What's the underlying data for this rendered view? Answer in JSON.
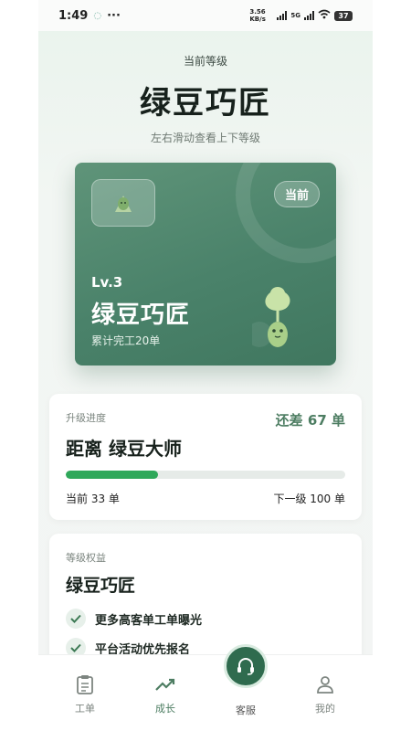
{
  "status_bar": {
    "time": "1:49",
    "speed": "3.56 KB/s",
    "network": "5G",
    "battery": "37"
  },
  "header": {
    "subtitle": "当前等级",
    "title": "绿豆巧匠",
    "hint": "左右滑动查看上下等级"
  },
  "level_card": {
    "tag": "当前",
    "level": "Lv.3",
    "name": "绿豆巧匠",
    "completed": "累计完工20单"
  },
  "progress": {
    "label": "升级进度",
    "remaining": "还差 67 单",
    "target": "距离 绿豆大师",
    "current": "当前 33 单",
    "next": "下一级 100 单",
    "fraction": 0.33
  },
  "benefits": {
    "label": "等级权益",
    "level_name": "绿豆巧匠",
    "items": [
      "更多高客单工单曝光",
      "平台活动优先报名"
    ]
  },
  "tabbar": {
    "orders": {
      "label": "工单",
      "icon": "clipboard-icon"
    },
    "growth": {
      "label": "成长",
      "icon": "trend-up-icon"
    },
    "service": {
      "label": "客服",
      "icon": "headset-icon"
    },
    "mine": {
      "label": "我的",
      "icon": "user-icon"
    }
  },
  "colors": {
    "accent": "#4d7d62",
    "progress": "#2fa85a",
    "card": "#4a826a"
  }
}
